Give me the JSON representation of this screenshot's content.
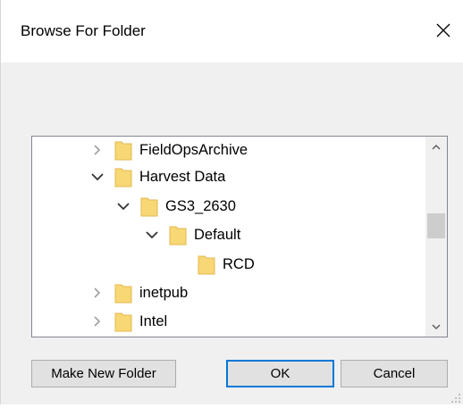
{
  "window": {
    "title": "Browse For Folder",
    "close_icon": "close-icon"
  },
  "tree": {
    "items": [
      {
        "label": "FieldOpsArchive",
        "state": "collapsed",
        "level": 0
      },
      {
        "label": "Harvest Data",
        "state": "expanded",
        "level": 0
      },
      {
        "label": "GS3_2630",
        "state": "expanded",
        "level": 1
      },
      {
        "label": "Default",
        "state": "expanded",
        "level": 2
      },
      {
        "label": "RCD",
        "state": "leaf",
        "level": 3
      },
      {
        "label": "inetpub",
        "state": "collapsed",
        "level": 0
      },
      {
        "label": "Intel",
        "state": "collapsed",
        "level": 0
      }
    ]
  },
  "buttons": {
    "make_new_folder": "Make New Folder",
    "ok": "OK",
    "cancel": "Cancel"
  },
  "colors": {
    "folder": "#f8d775",
    "folder_dark": "#e3b84f",
    "default_button_border": "#0078d7"
  }
}
